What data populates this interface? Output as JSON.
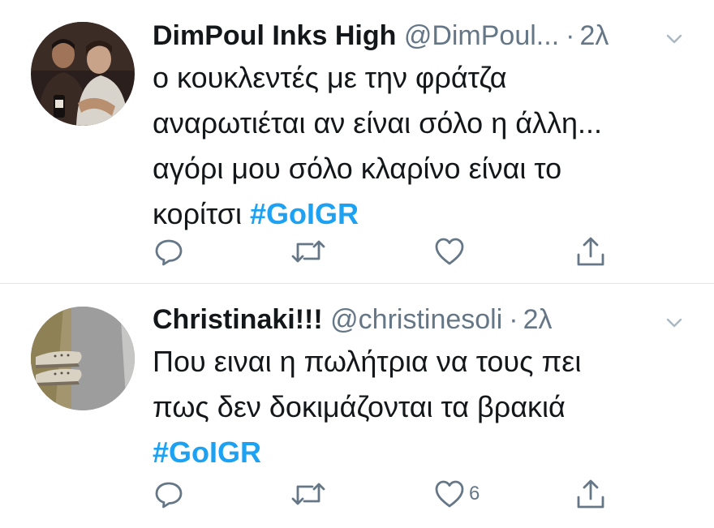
{
  "colors": {
    "text": "#14171a",
    "secondary": "#657786",
    "hashtag": "#1da1f2",
    "divider": "#e1e8ed"
  },
  "tweets": [
    {
      "display_name": "DimPoul Inks High",
      "handle": "@DimPoul...",
      "dot": "·",
      "time": "2λ",
      "lines": [
        "ο κουκλεντές με την φράτζα",
        "αναρωτιέται αν είναι σόλο η άλλη...",
        "αγόρι μου σόλο κλαρίνο είναι το",
        "κορίτσι "
      ],
      "hashtag": "#GoIGR",
      "avatar_icon": "avatar-two-men-photo",
      "actions": {
        "reply_icon": "reply-icon",
        "retweet_icon": "retweet-icon",
        "like_icon": "heart-icon",
        "like_count": "",
        "share_icon": "share-icon"
      }
    },
    {
      "display_name": "Christinaki!!!",
      "handle": "@christinesoli",
      "dot": "·",
      "time": "2λ",
      "lines": [
        "Που ειναι η πωλήτρια να τους πει",
        "πως δεν δοκιμάζονται τα βρακιά"
      ],
      "hashtag": "#GoIGR",
      "avatar_icon": "avatar-sneakers-photo",
      "actions": {
        "reply_icon": "reply-icon",
        "retweet_icon": "retweet-icon",
        "like_icon": "heart-icon",
        "like_count": "6",
        "share_icon": "share-icon"
      }
    }
  ]
}
